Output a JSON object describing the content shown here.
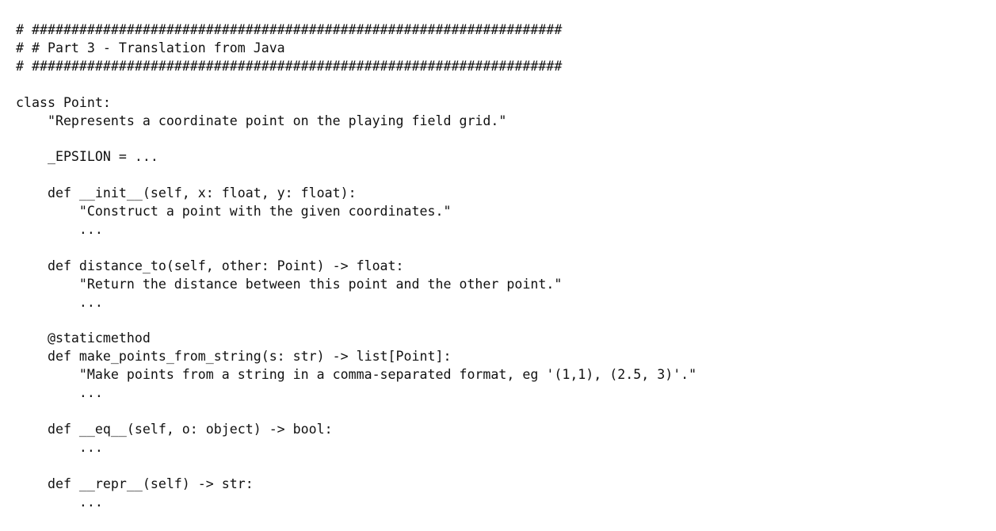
{
  "document": {
    "kind": "python-source-listing",
    "background_color": "#ffffff",
    "text_color": "#111111",
    "font_kind": "monospace",
    "section_title": "Part 3 - Translation from Java",
    "class_name": "Point",
    "lines": [
      "# ###################################################################",
      "# # Part 3 - Translation from Java",
      "# ###################################################################",
      "",
      "class Point:",
      "    \"Represents a coordinate point on the playing field grid.\"",
      "",
      "    _EPSILON = ...",
      "",
      "    def __init__(self, x: float, y: float):",
      "        \"Construct a point with the given coordinates.\"",
      "        ...",
      "",
      "    def distance_to(self, other: Point) -> float:",
      "        \"Return the distance between this point and the other point.\"",
      "        ...",
      "",
      "    @staticmethod",
      "    def make_points_from_string(s: str) -> list[Point]:",
      "        \"Make points from a string in a comma-separated format, eg '(1,1), (2.5, 3)'.\"",
      "        ...",
      "",
      "    def __eq__(self, o: object) -> bool:",
      "        ...",
      "",
      "    def __repr__(self) -> str:",
      "        ..."
    ]
  }
}
